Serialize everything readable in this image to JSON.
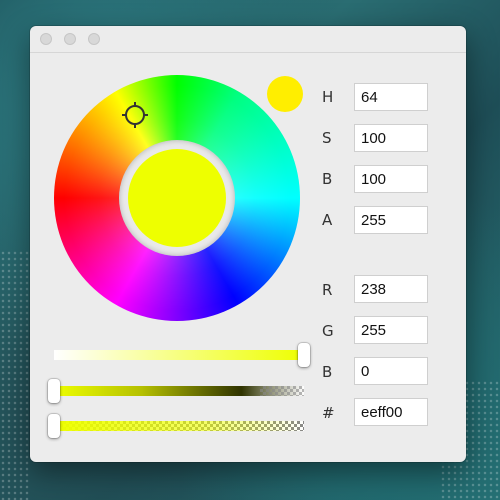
{
  "window": {
    "close_icon": "circle-gray",
    "minimize_icon": "circle-gray",
    "zoom_icon": "circle-gray"
  },
  "color": {
    "current_hex_color": "#eeff00",
    "swatch_color": "#ffee00"
  },
  "hsba": {
    "h_label": "H",
    "h_value": "64",
    "s_label": "S",
    "s_value": "100",
    "b_label": "B",
    "b_value": "100",
    "a_label": "A",
    "a_value": "255"
  },
  "rgb": {
    "r_label": "R",
    "r_value": "238",
    "g_label": "G",
    "g_value": "255",
    "b_label": "B",
    "b_value": "0",
    "hex_label": "#",
    "hex_value": "eeff00"
  },
  "sliders": {
    "brightness_level": 1.0,
    "shade_level": 0.0,
    "alpha_level": 0.0
  }
}
